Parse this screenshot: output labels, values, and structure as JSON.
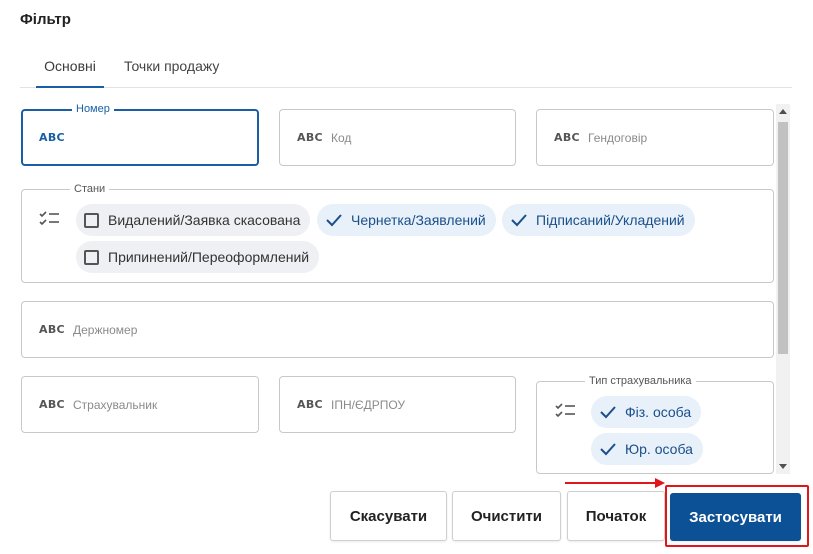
{
  "dialog": {
    "title": "Фільтр"
  },
  "tabs": [
    {
      "label": "Основні",
      "active": true
    },
    {
      "label": "Точки продажу",
      "active": false
    }
  ],
  "fields": {
    "abc": "ABC",
    "number": {
      "legend": "Номер",
      "value": ""
    },
    "code": {
      "placeholder": "Код"
    },
    "master_agreement": {
      "placeholder": "Гендоговір"
    },
    "plate_number": {
      "placeholder": "Держномер"
    },
    "insurer": {
      "placeholder": "Страхувальник"
    },
    "tax_id": {
      "placeholder": "ІПН/ЄДРПОУ"
    }
  },
  "states": {
    "legend": "Стани",
    "options": [
      {
        "label": "Видалений/Заявка скасована",
        "selected": false
      },
      {
        "label": "Чернетка/Заявлений",
        "selected": true
      },
      {
        "label": "Підписаний/Укладений",
        "selected": true
      },
      {
        "label": "Припинений/Переоформлений",
        "selected": false
      }
    ]
  },
  "insurer_type": {
    "legend": "Тип страхувальника",
    "options": [
      {
        "label": "Фіз. особа",
        "selected": true
      },
      {
        "label": "Юр. особа",
        "selected": true
      }
    ]
  },
  "buttons": {
    "cancel": "Скасувати",
    "clear": "Очистити",
    "initial": "Початок",
    "apply": "Застосувати"
  },
  "colors": {
    "accent": "#1a5fa6",
    "primary_button": "#0c5096",
    "annotation": "#e0161b",
    "chip_selected": "#e8f0fa",
    "chip_default": "#eef0f3"
  },
  "icons": {
    "field_type": "abc-icon",
    "list": "checklist-icon",
    "check": "check-icon"
  }
}
